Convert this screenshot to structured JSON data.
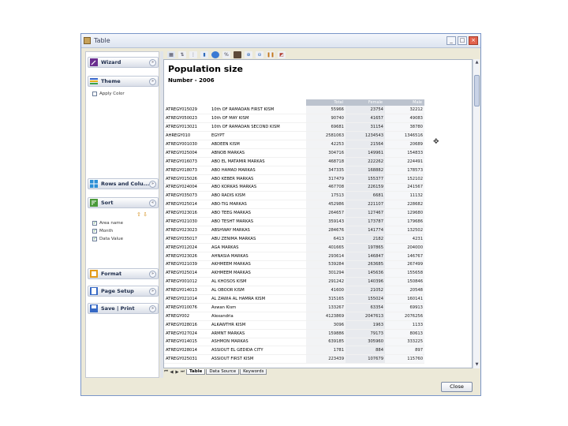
{
  "window": {
    "title": "Table",
    "min": "_",
    "max": "□",
    "close": "×"
  },
  "sidebar": {
    "panels": {
      "wizard": "Wizard",
      "theme": "Theme",
      "rows_cols": "Rows and Colu...",
      "sort": "Sort",
      "format": "Format",
      "page_setup": "Page Setup",
      "save_print": "Save | Print"
    },
    "theme_option": "Apply Color",
    "sort_fields": [
      "Area name",
      "Month",
      "Data Value"
    ],
    "collapse_glyph": "»",
    "expand_glyph": "«"
  },
  "toolbar": {
    "icons": [
      "table-icon",
      "sort-icon",
      "filter-icon",
      "chart-icon",
      "map-icon",
      "percent-icon",
      "export-icon",
      "zoom-in-icon",
      "zoom-out-icon",
      "columns-icon",
      "pdf-icon"
    ]
  },
  "report": {
    "title": "Population size",
    "subtitle": "Number - 2006",
    "columns": [
      "Total",
      "Female",
      "Male"
    ],
    "rows": [
      [
        "ATREGY015029",
        "10th OF RAMADAN FIRST KISM",
        "55966",
        "23754",
        "32212"
      ],
      [
        "ATREGY050023",
        "10th OF MAY KISM",
        "90740",
        "41657",
        "49083"
      ],
      [
        "ATREGY013021",
        "10th OF RAMADAN SECOND KISM",
        "69681",
        "31154",
        "38780"
      ],
      [
        "AHREGY010",
        "EGYPT",
        "2581063",
        "1234543",
        "1346516"
      ],
      [
        "ATREGY001030",
        "ABDEEN KISM",
        "42253",
        "21564",
        "20689"
      ],
      [
        "ATREGY025004",
        "ABNOB MARKAS",
        "304716",
        "149961",
        "154833"
      ],
      [
        "ATREGY016073",
        "ABO EL MATAMIR MARKAS",
        "468718",
        "222262",
        "224491"
      ],
      [
        "ATREGY018073",
        "ABO HAMAD MARKAS",
        "347335",
        "168882",
        "178573"
      ],
      [
        "ATREGY015026",
        "ABO KEBER MARKAS",
        "317479",
        "155377",
        "152102"
      ],
      [
        "ATREGY024004",
        "ABO KORKAS MARKAS",
        "467708",
        "226159",
        "241567"
      ],
      [
        "ATREGY035073",
        "ABO RADIS KISM",
        "17513",
        "6681",
        "11132"
      ],
      [
        "ATREGY025014",
        "ABO-TIG MARKAS",
        "452986",
        "221107",
        "228682"
      ],
      [
        "ATREGY023016",
        "ABO TEEG MARKAS",
        "264657",
        "127467",
        "129680"
      ],
      [
        "ATREGY021030",
        "ABO TESHT MARKAS",
        "359143",
        "173787",
        "179686"
      ],
      [
        "ATREGY023023",
        "ABSHWAY MARKAS",
        "284676",
        "141774",
        "132502"
      ],
      [
        "ATREGY035017",
        "ABU ZENIMA MARKAS",
        "6413",
        "2182",
        "4231"
      ],
      [
        "ATREGY012024",
        "AGA MARKAS",
        "401665",
        "197865",
        "204000"
      ],
      [
        "ATREGY023026",
        "AHNASIA MARKAS",
        "293614",
        "146847",
        "146767"
      ],
      [
        "ATREGY021039",
        "AKHMEEM MARKAS",
        "539284",
        "263685",
        "267499"
      ],
      [
        "ATREGY025014",
        "AKHMEEM MARKAS",
        "301294",
        "145636",
        "155658"
      ],
      [
        "ATREGY001012",
        "AL KHOSOS KISM",
        "291242",
        "140396",
        "150846"
      ],
      [
        "ATREGY014013",
        "AL OBOOR KISM",
        "41600",
        "21052",
        "20548"
      ],
      [
        "ATREGY021014",
        "AL ZAWIA AL HAMRA KISM",
        "315165",
        "155024",
        "160141"
      ],
      [
        "ATREGY010076",
        "Aswan Kism",
        "133267",
        "63354",
        "69913"
      ],
      [
        "ATREGY002",
        "Alexandria",
        "4123869",
        "2047613",
        "2076256"
      ],
      [
        "ATREGY028016",
        "ALKAWTHR KISM",
        "3096",
        "1963",
        "1133"
      ],
      [
        "ATREGY027024",
        "ARMNT MARKAS",
        "159886",
        "79173",
        "80613"
      ],
      [
        "ATREGY014015",
        "ASHMON MARKAS",
        "639185",
        "305960",
        "333225"
      ],
      [
        "ATREGY028014",
        "ASSIOUT EL GEDIDA CITY",
        "1781",
        "884",
        "897"
      ],
      [
        "ATREGY025031",
        "ASSIOUT FIRST KISM",
        "223439",
        "107679",
        "115760"
      ]
    ]
  },
  "tabs": {
    "nav": [
      "⏮",
      "◀",
      "▶",
      "⏭"
    ],
    "sheets": [
      "Table",
      "Data Source",
      "Keywords"
    ]
  },
  "footer": {
    "close_label": "Close"
  },
  "scroll": {
    "up": "▲",
    "down": "▼"
  }
}
